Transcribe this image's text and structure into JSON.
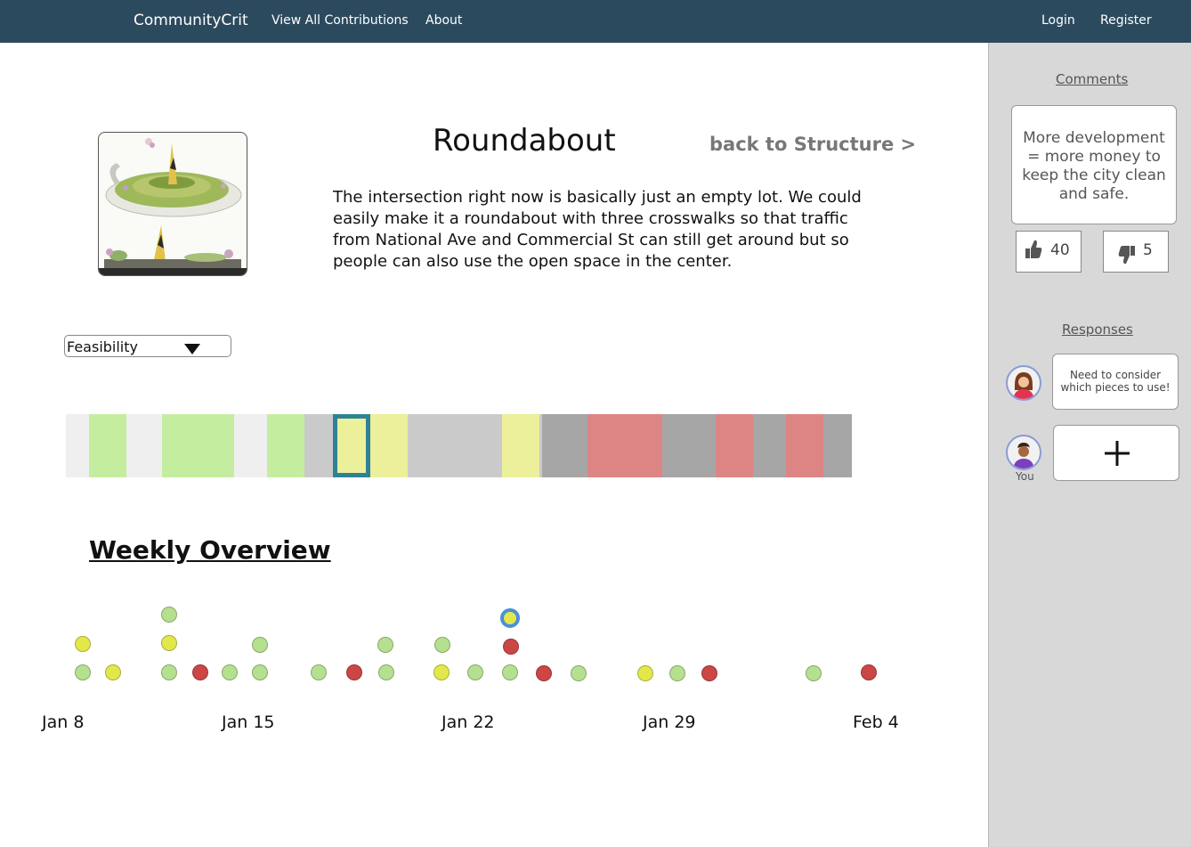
{
  "nav": {
    "brand": "CommunityCrit",
    "view_all": "View All Contributions",
    "about": "About",
    "login": "Login",
    "register": "Register"
  },
  "idea": {
    "title": "Roundabout",
    "back_link": "back to Structure >",
    "description": "The intersection right now is basically just an empty lot. We could easily make it a roundabout with three crosswalks so that traffic from National Ave and Commercial St can still get around but so people can also use the open space in the center."
  },
  "filter": {
    "selected": "Feasibility"
  },
  "weekly": {
    "title": "Weekly Overview",
    "dates": [
      "Jan 8",
      "Jan 15",
      "Jan 22",
      "Jan 29",
      "Feb 4"
    ]
  },
  "sidebar": {
    "comments_heading": "Comments",
    "comment_text": "More development = more money to keep the city clean and safe.",
    "upvotes": "40",
    "downvotes": "5",
    "responses_heading": "Responses",
    "response_text": "Need to consider which pieces to use!",
    "you_label": "You"
  },
  "colors": {
    "navbar": "#2c4a5e",
    "green": "#c5eda0",
    "yellow": "#ecf09a",
    "red": "#dd8585",
    "light_gray": "#efefef",
    "mid_gray": "#cacaca",
    "dark_gray": "#a6a6a6",
    "selected_border": "#2f8296",
    "highlight_ring": "#4a90d9",
    "dot_green": "#b5e08f",
    "dot_yellow": "#e3e84a",
    "dot_red": "#cc4646"
  }
}
